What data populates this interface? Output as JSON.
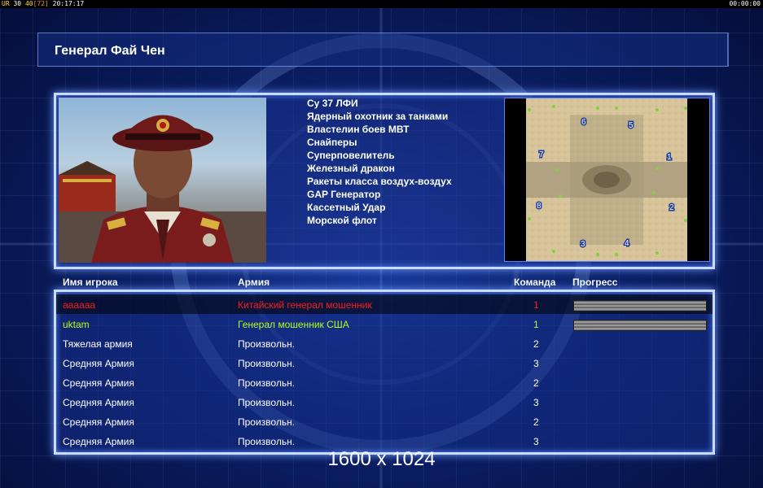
{
  "status_bar": {
    "left_prefix": "UR",
    "left_a": "30",
    "left_b": "40",
    "left_c": "[72]",
    "left_time": "20:17:17",
    "right_time": "00:00:00"
  },
  "general": {
    "title": "Генерал Фай Чен",
    "abilities": [
      "Су 37 ЛФИ",
      "Ядерный охотник за танками",
      "Властелин боев МВТ",
      "Снайперы",
      "Суперповелитель",
      "Железный дракон",
      "Ракеты класса воздух-воздух",
      "GAP Генератор",
      "Кассетный Удар",
      "Морской флот"
    ]
  },
  "map": {
    "start_positions": [
      "6",
      "5",
      "7",
      "1",
      "8",
      "2",
      "3",
      "4"
    ]
  },
  "table": {
    "headers": {
      "player_name": "Имя игрока",
      "army": "Армия",
      "team": "Команда",
      "progress": "Прогресс"
    },
    "rows": [
      {
        "name": "аааааа",
        "army": "Китайский генерал мошенник",
        "team": "1",
        "color": "#ff1a1a",
        "progress": 1.0
      },
      {
        "name": "uktam",
        "army": "Генерал мошенник США",
        "team": "1",
        "color": "#b6ff1a",
        "progress": 1.0
      },
      {
        "name": "Тяжелая армия",
        "army": "Произвольн.",
        "team": "2",
        "color": "#ffffff"
      },
      {
        "name": "Средняя Армия",
        "army": "Произвольн.",
        "team": "3",
        "color": "#ffffff"
      },
      {
        "name": "Средняя Армия",
        "army": "Произвольн.",
        "team": "2",
        "color": "#ffffff"
      },
      {
        "name": "Средняя Армия",
        "army": "Произвольн.",
        "team": "3",
        "color": "#ffffff"
      },
      {
        "name": "Средняя Армия",
        "army": "Произвольн.",
        "team": "2",
        "color": "#ffffff"
      },
      {
        "name": "Средняя Армия",
        "army": "Произвольн.",
        "team": "3",
        "color": "#ffffff"
      }
    ]
  },
  "resolution_label": "1600 x 1024"
}
